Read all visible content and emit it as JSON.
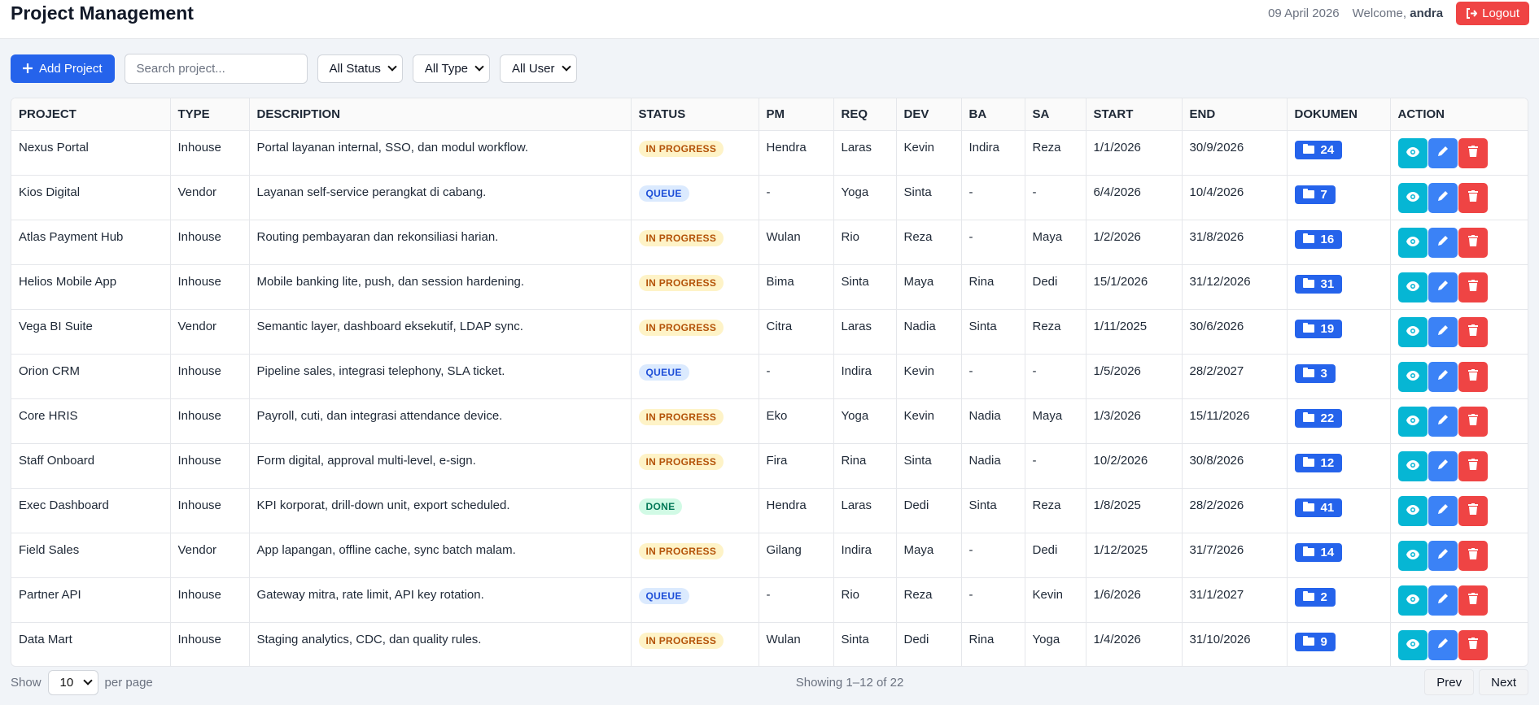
{
  "header": {
    "title": "Project Management",
    "date": "09 April 2026",
    "welcome_prefix": "Welcome,",
    "username": "andra",
    "logout_label": "Logout"
  },
  "toolbar": {
    "add_label": "Add Project",
    "search_placeholder": "Search project...",
    "status_filter": "All Status",
    "type_filter": "All Type",
    "user_filter": "All User"
  },
  "table": {
    "columns": [
      "Project",
      "Type",
      "Description",
      "Status",
      "PM",
      "REQ",
      "DEV",
      "BA",
      "SA",
      "Start",
      "End",
      "Dokumen",
      "Action"
    ],
    "rows": [
      {
        "project": "Nexus Portal",
        "type": "Inhouse",
        "description": "Portal layanan internal, SSO, dan modul workflow.",
        "status": "IN PROGRESS",
        "status_kind": "inprogress",
        "pm": "Hendra",
        "req": "Laras",
        "dev": "Kevin",
        "ba": "Indira",
        "sa": "Reza",
        "start": "1/1/2026",
        "end": "30/9/2026",
        "docs": "24"
      },
      {
        "project": "Kios Digital",
        "type": "Vendor",
        "description": "Layanan self-service perangkat di cabang.",
        "status": "QUEUE",
        "status_kind": "queue",
        "pm": "-",
        "req": "Yoga",
        "dev": "Sinta",
        "ba": "-",
        "sa": "-",
        "start": "6/4/2026",
        "end": "10/4/2026",
        "docs": "7"
      },
      {
        "project": "Atlas Payment Hub",
        "type": "Inhouse",
        "description": "Routing pembayaran dan rekonsiliasi harian.",
        "status": "IN PROGRESS",
        "status_kind": "inprogress",
        "pm": "Wulan",
        "req": "Rio",
        "dev": "Reza",
        "ba": "-",
        "sa": "Maya",
        "start": "1/2/2026",
        "end": "31/8/2026",
        "docs": "16"
      },
      {
        "project": "Helios Mobile App",
        "type": "Inhouse",
        "description": "Mobile banking lite, push, dan session hardening.",
        "status": "IN PROGRESS",
        "status_kind": "inprogress",
        "pm": "Bima",
        "req": "Sinta",
        "dev": "Maya",
        "ba": "Rina",
        "sa": "Dedi",
        "start": "15/1/2026",
        "end": "31/12/2026",
        "docs": "31"
      },
      {
        "project": "Vega BI Suite",
        "type": "Vendor",
        "description": "Semantic layer, dashboard eksekutif, LDAP sync.",
        "status": "IN PROGRESS",
        "status_kind": "inprogress",
        "pm": "Citra",
        "req": "Laras",
        "dev": "Nadia",
        "ba": "Sinta",
        "sa": "Reza",
        "start": "1/11/2025",
        "end": "30/6/2026",
        "docs": "19"
      },
      {
        "project": "Orion CRM",
        "type": "Inhouse",
        "description": "Pipeline sales, integrasi telephony, SLA ticket.",
        "status": "QUEUE",
        "status_kind": "queue",
        "pm": "-",
        "req": "Indira",
        "dev": "Kevin",
        "ba": "-",
        "sa": "-",
        "start": "1/5/2026",
        "end": "28/2/2027",
        "docs": "3"
      },
      {
        "project": "Core HRIS",
        "type": "Inhouse",
        "description": "Payroll, cuti, dan integrasi attendance device.",
        "status": "IN PROGRESS",
        "status_kind": "inprogress",
        "pm": "Eko",
        "req": "Yoga",
        "dev": "Kevin",
        "ba": "Nadia",
        "sa": "Maya",
        "start": "1/3/2026",
        "end": "15/11/2026",
        "docs": "22"
      },
      {
        "project": "Staff Onboard",
        "type": "Inhouse",
        "description": "Form digital, approval multi-level, e-sign.",
        "status": "IN PROGRESS",
        "status_kind": "inprogress",
        "pm": "Fira",
        "req": "Rina",
        "dev": "Sinta",
        "ba": "Nadia",
        "sa": "-",
        "start": "10/2/2026",
        "end": "30/8/2026",
        "docs": "12"
      },
      {
        "project": "Exec Dashboard",
        "type": "Inhouse",
        "description": "KPI korporat, drill-down unit, export scheduled.",
        "status": "DONE",
        "status_kind": "done",
        "pm": "Hendra",
        "req": "Laras",
        "dev": "Dedi",
        "ba": "Sinta",
        "sa": "Reza",
        "start": "1/8/2025",
        "end": "28/2/2026",
        "docs": "41"
      },
      {
        "project": "Field Sales",
        "type": "Vendor",
        "description": "App lapangan, offline cache, sync batch malam.",
        "status": "IN PROGRESS",
        "status_kind": "inprogress",
        "pm": "Gilang",
        "req": "Indira",
        "dev": "Maya",
        "ba": "-",
        "sa": "Dedi",
        "start": "1/12/2025",
        "end": "31/7/2026",
        "docs": "14"
      },
      {
        "project": "Partner API",
        "type": "Inhouse",
        "description": "Gateway mitra, rate limit, API key rotation.",
        "status": "QUEUE",
        "status_kind": "queue",
        "pm": "-",
        "req": "Rio",
        "dev": "Reza",
        "ba": "-",
        "sa": "Kevin",
        "start": "1/6/2026",
        "end": "31/1/2027",
        "docs": "2"
      },
      {
        "project": "Data Mart",
        "type": "Inhouse",
        "description": "Staging analytics, CDC, dan quality rules.",
        "status": "IN PROGRESS",
        "status_kind": "inprogress",
        "pm": "Wulan",
        "req": "Sinta",
        "dev": "Dedi",
        "ba": "Rina",
        "sa": "Yoga",
        "start": "1/4/2026",
        "end": "31/10/2026",
        "docs": "9"
      }
    ]
  },
  "footer": {
    "show_label": "Show",
    "per_page": "10",
    "per_page_label": "per page",
    "showing": "Showing 1–12 of 22",
    "prev_label": "Prev",
    "next_label": "Next"
  },
  "colors": {
    "primary": "#2563eb",
    "danger": "#ef4444",
    "info": "#06b6d4"
  }
}
